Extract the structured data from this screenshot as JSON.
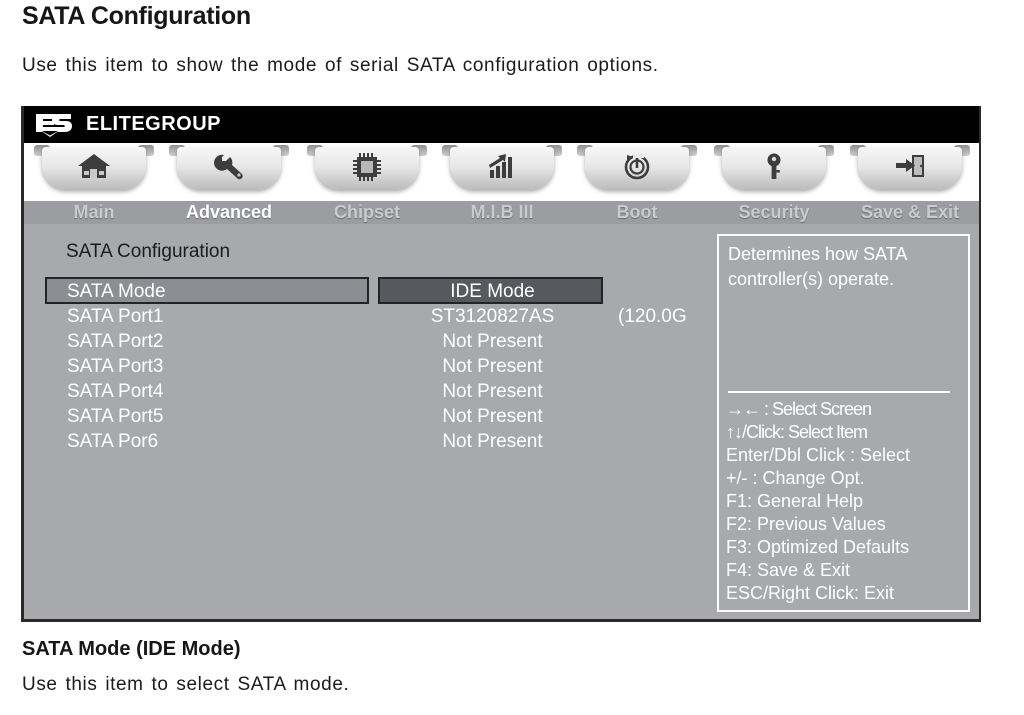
{
  "document": {
    "title": "SATA Configuration",
    "subtitle": "Use this item to show the mode of serial SATA configuration options.",
    "caption_title": "SATA Mode (IDE Mode)",
    "caption_text": "Use this item to select SATA mode."
  },
  "bios": {
    "brand": {
      "logo_mark": "ecs-logo",
      "logo_text": "ELITEGROUP"
    },
    "tabs": [
      {
        "label": "Main",
        "icon": "home-icon",
        "active": false
      },
      {
        "label": "Advanced",
        "icon": "wrench-icon",
        "active": true
      },
      {
        "label": "Chipset",
        "icon": "chip-icon",
        "active": false
      },
      {
        "label": "M.I.B III",
        "icon": "chart-icon",
        "active": false
      },
      {
        "label": "Boot",
        "icon": "power-icon",
        "active": false
      },
      {
        "label": "Security",
        "icon": "key-icon",
        "active": false
      },
      {
        "label": "Save & Exit",
        "icon": "exit-door-icon",
        "active": false
      }
    ],
    "section_title": "SATA Configuration",
    "rows": [
      {
        "label": "SATA Mode",
        "value": "IDE Mode",
        "extra": "",
        "selected": true
      },
      {
        "label": "SATA Port1",
        "value": "ST3120827AS",
        "extra": "(120.0G",
        "selected": false
      },
      {
        "label": "SATA Port2",
        "value": "Not Present",
        "extra": "",
        "selected": false
      },
      {
        "label": "SATA Port3",
        "value": "Not Present",
        "extra": "",
        "selected": false
      },
      {
        "label": "SATA Port4",
        "value": "Not Present",
        "extra": "",
        "selected": false
      },
      {
        "label": "SATA Port5",
        "value": "Not Present",
        "extra": "",
        "selected": false
      },
      {
        "label": "SATA Por6",
        "value": "Not Present",
        "extra": "",
        "selected": false
      }
    ],
    "help": {
      "description": "Determines how SATA controller(s) operate.",
      "keys": [
        "→←   : Select Screen",
        "↑↓/Click: Select Item",
        "Enter/Dbl Click : Select",
        "+/- : Change Opt.",
        "F1: General Help",
        "F2: Previous Values",
        "F3: Optimized Defaults",
        "F4: Save & Exit",
        "ESC/Right Click: Exit"
      ]
    },
    "colors": {
      "panel_bg": "#a7a9ac",
      "strip_bg": "#9b9da0",
      "select_left": "#8b8e92",
      "select_right": "#56595e",
      "brand_bar": "#000000",
      "text_light": "#ffffff",
      "text_dark": "#1c1c1c"
    }
  }
}
